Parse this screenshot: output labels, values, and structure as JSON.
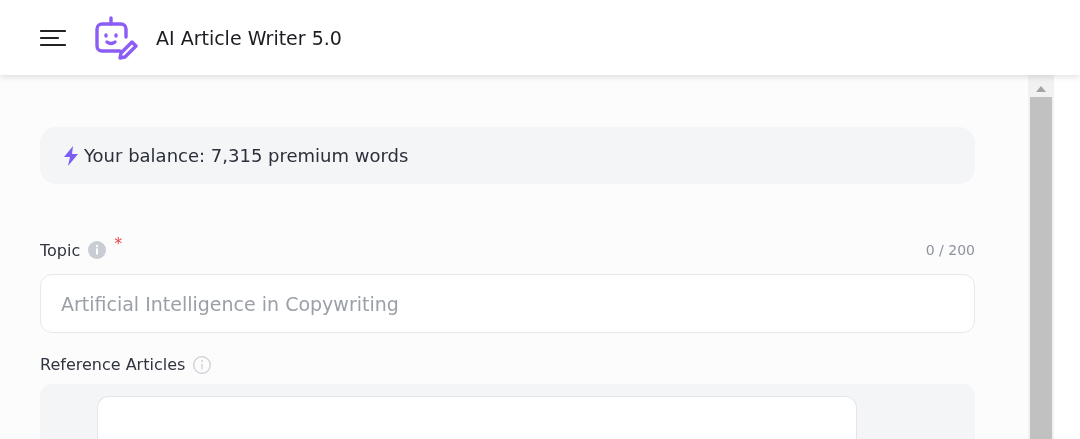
{
  "header": {
    "title": "AI Article Writer 5.0"
  },
  "balance": {
    "text": "Your balance: 7,315 premium words"
  },
  "topic": {
    "label": "Topic",
    "required_mark": "*",
    "counter": "0 / 200",
    "placeholder": "Artificial Intelligence in Copywriting"
  },
  "reference_articles": {
    "label": "Reference Articles"
  }
}
